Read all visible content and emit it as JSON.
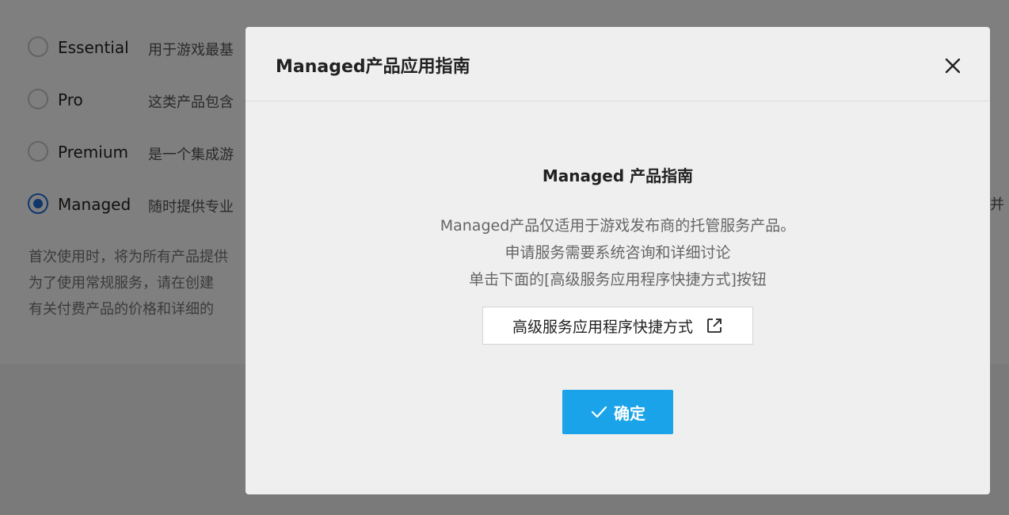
{
  "background": {
    "plans": [
      {
        "name": "Essential",
        "desc": "用于游戏最基",
        "checked": false
      },
      {
        "name": "Pro",
        "desc": "这类产品包含",
        "checked": false
      },
      {
        "name": "Premium",
        "desc": "是一个集成游",
        "checked": false
      },
      {
        "name": "Managed",
        "desc": "随时提供专业",
        "checked": true
      }
    ],
    "right_clipped_text": "并",
    "notes": [
      "首次使用时，将为所有产品提供",
      "为了使用常规服务，请在创建",
      "有关付费产品的价格和详细的"
    ]
  },
  "modal": {
    "title": "Managed产品应用指南",
    "close_icon": "close-icon",
    "guide_title": "Managed 产品指南",
    "guide_lines": [
      "Managed产品仅适用于游戏发布商的托管服务产品。",
      "申请服务需要系统咨询和详细讨论",
      "单击下面的[高级服务应用程序快捷方式]按钮"
    ],
    "shortcut_button": {
      "label": "高级服务应用程序快捷方式",
      "icon": "external-link-icon"
    },
    "confirm_button": {
      "label": "确定",
      "icon": "check-icon"
    }
  },
  "colors": {
    "accent": "#1aa3e8",
    "radio_checked": "#1e6fd9",
    "overlay": "rgba(0,0,0,0.5)"
  }
}
